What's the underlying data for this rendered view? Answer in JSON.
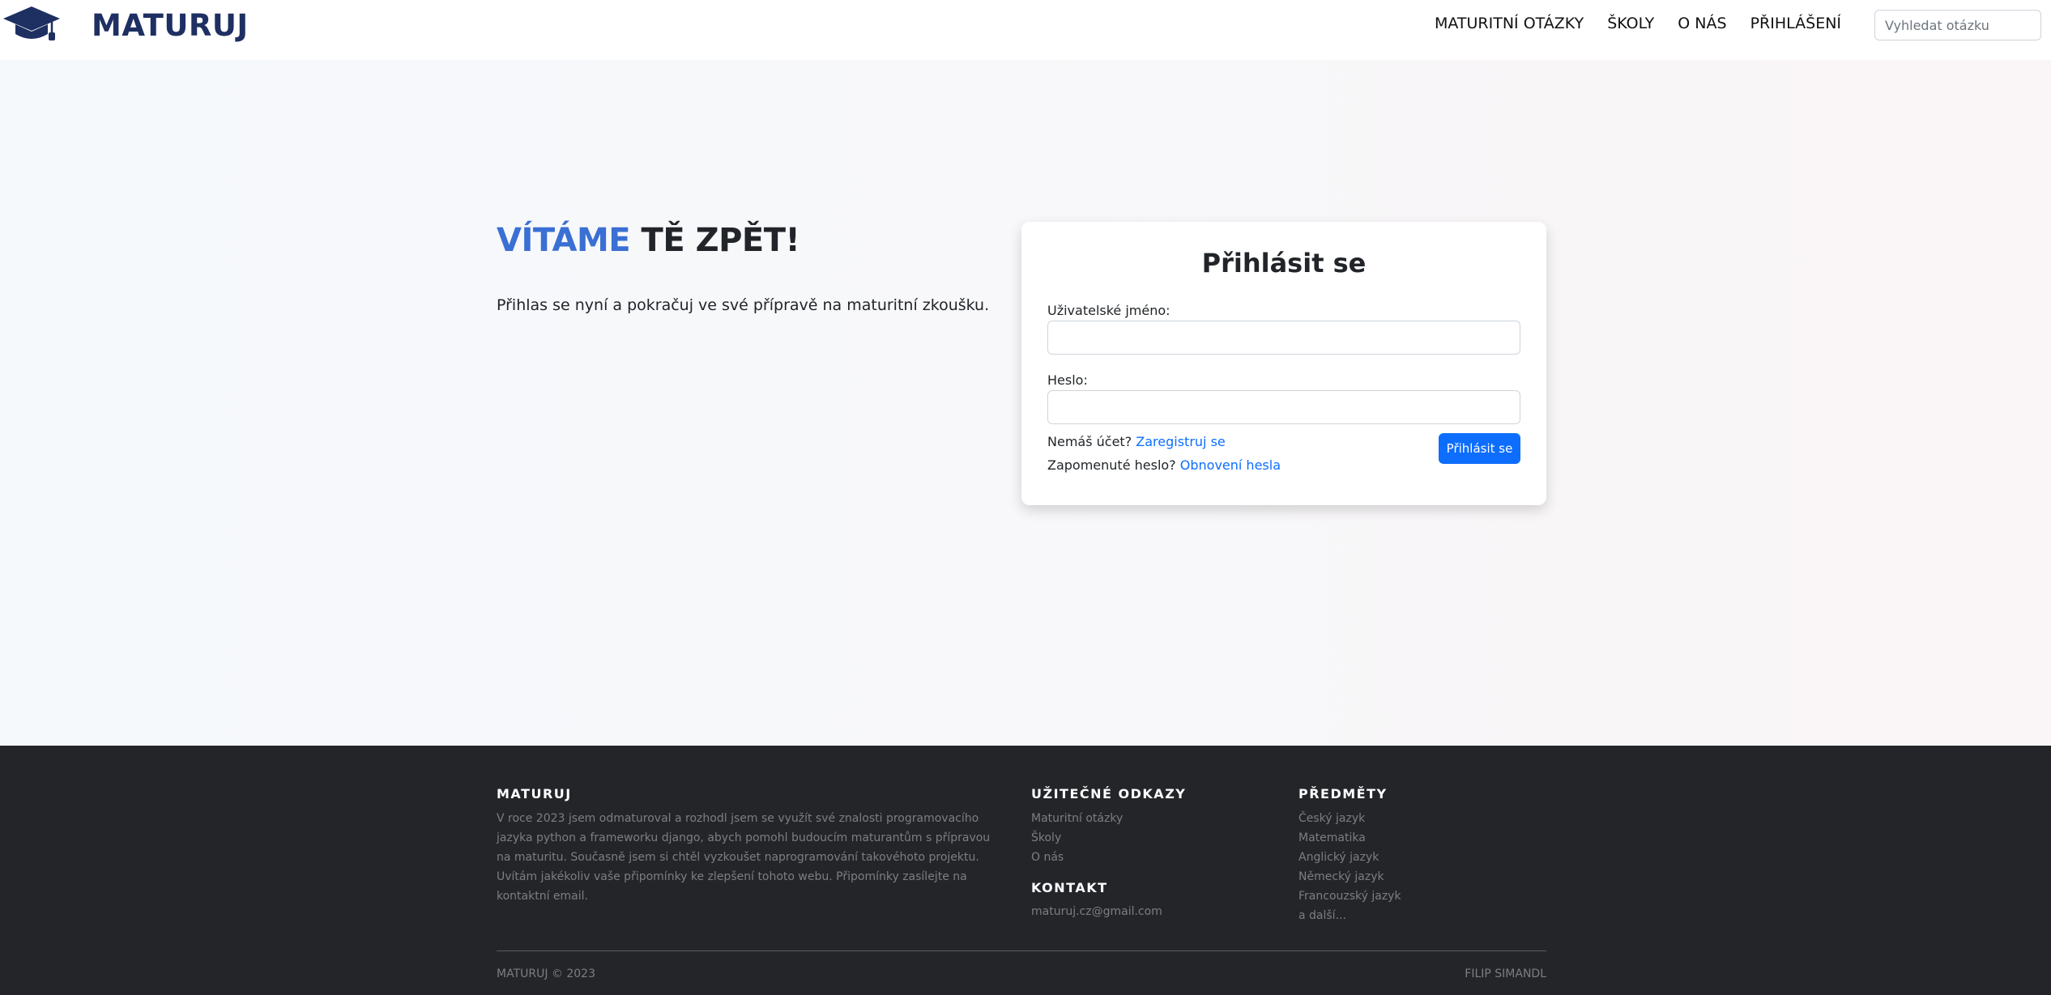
{
  "colors": {
    "brand": "#1e2f62",
    "accent": "#3a6fd3",
    "primary_button": "#0d6efd",
    "footer_bg": "#242529",
    "footer_text": "#7c7e83"
  },
  "navbar": {
    "logo_icon": "graduation-cap-icon",
    "brand": "MATURUJ",
    "links": [
      {
        "label": "MATURITNÍ OTÁZKY"
      },
      {
        "label": "ŠKOLY"
      },
      {
        "label": "O NÁS"
      },
      {
        "label": "PŘIHLÁŠENÍ"
      }
    ],
    "search_placeholder": "Vyhledat otázku"
  },
  "welcome": {
    "title_accent": "VÍTÁME",
    "title_rest": " TĚ ZPĚT!",
    "subtitle": "Přihlas se nyní a pokračuj ve své přípravě na maturitní zkoušku."
  },
  "login": {
    "title": "Přihlásit se",
    "username_label": "Uživatelské jméno:",
    "username_value": "",
    "password_label": "Heslo:",
    "password_value": "",
    "no_account_text": "Nemáš účet? ",
    "register_link": "Zaregistruj se",
    "forgot_text": "Zapomenuté heslo? ",
    "reset_link": "Obnovení hesla",
    "submit_label": "Přihlásit se"
  },
  "footer": {
    "about": {
      "heading": "MATURUJ",
      "text": "V roce 2023 jsem odmaturoval a rozhodl jsem se využít své znalosti programovacího jazyka python a frameworku django, abych pomohl budoucím maturantům s přípravou na maturitu. Současně jsem si chtěl vyzkoušet naprogramování takovéhoto projektu. Uvítám jakékoliv vaše připomínky ke zlepšení tohoto webu. Připomínky zasílejte na kontaktní email."
    },
    "links": {
      "heading": "UŽITEČNÉ ODKAZY",
      "items": [
        "Maturitní otázky",
        "Školy",
        "O nás"
      ]
    },
    "contact": {
      "heading": "KONTAKT",
      "email": "maturuj.cz@gmail.com"
    },
    "subjects": {
      "heading": "PŘEDMĚTY",
      "items": [
        "Český jazyk",
        "Matematika",
        "Anglický jazyk",
        "Německý jazyk",
        "Francouzský jazyk",
        "a další..."
      ]
    },
    "copyright": "MATURUJ © 2023",
    "author": "FILIP SIMANDL"
  }
}
